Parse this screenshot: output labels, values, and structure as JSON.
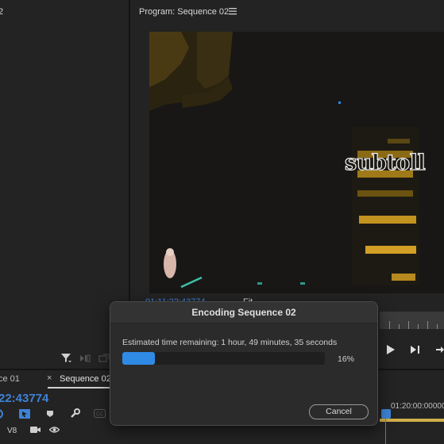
{
  "left_panel": {
    "tab_label": "2"
  },
  "program_monitor": {
    "title": "Program: Sequence 02",
    "current_timecode": "01:11:22:43774",
    "fit_label": "Fit",
    "subtitle_overlay": "subtoll",
    "menu_icon": "hamburger-icon"
  },
  "timeline": {
    "tabs": [
      {
        "label": "ce 01"
      },
      {
        "label": "Sequence 02"
      }
    ],
    "tab_close": "×",
    "timecode": "22:43774",
    "ruler_label": "01:20:00:00000",
    "track_label": "V8",
    "accent_color": "#3d82d6"
  },
  "encoding_dialog": {
    "title": "Encoding Sequence 02",
    "estimated_time": "Estimated time remaining: 1 hour, 49 minutes, 35 seconds",
    "progress": 0.16,
    "progress_label": "16%",
    "cancel_label": "Cancel",
    "progress_color": "#2f8ae6"
  }
}
